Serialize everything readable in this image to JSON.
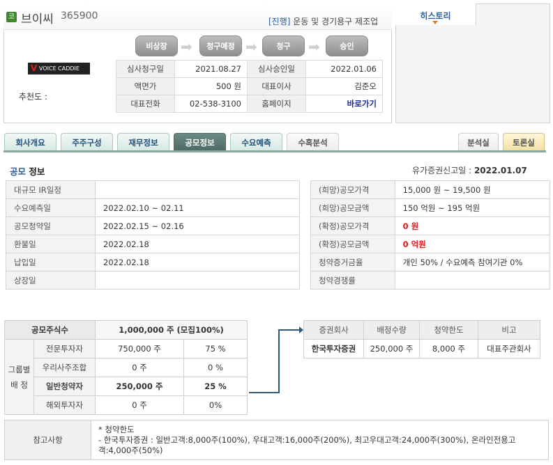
{
  "company": {
    "icon_char": "코",
    "name": "브이씨",
    "code": "365900",
    "status_tag": "[진행]",
    "industry": "운동 및 경기용구 제조업",
    "logo_text": "VOICE CADDIE",
    "recommend_label": "추천도 :"
  },
  "steps": [
    "비상장",
    "청구예정",
    "청구",
    "승인"
  ],
  "info_rows": [
    {
      "l1": "심사청구일",
      "v1": "2021.08.27",
      "l2": "심사승인일",
      "v2": "2022.01.06"
    },
    {
      "l1": "액면가",
      "v1": "500 원",
      "l2": "대표이사",
      "v2": "김준오"
    },
    {
      "l1": "대표전화",
      "v1": "02-538-3100",
      "l2": "홈페이지",
      "v2": "바로가기"
    }
  ],
  "history": {
    "tab_label": "히스토리"
  },
  "tabs": [
    "회사개요",
    "주주구성",
    "재무정보",
    "공모정보",
    "수요예측",
    "수혹분석"
  ],
  "right_tabs": [
    "분석실",
    "토론실"
  ],
  "section": {
    "title_a": "공모",
    "title_b": " 정보",
    "filed_label": "유가증권신고일 : ",
    "filed_date": "2022.01.07"
  },
  "schedule": [
    {
      "label": "대규모 IR일정",
      "value": ""
    },
    {
      "label": "수요예측일",
      "value": "2022.02.10 ~ 02.11"
    },
    {
      "label": "공모청약일",
      "value": "2022.02.15 ~ 02.16"
    },
    {
      "label": "환불일",
      "value": "2022.02.18"
    },
    {
      "label": "납입일",
      "value": "2022.02.18"
    },
    {
      "label": "상장일",
      "value": ""
    }
  ],
  "pricing": [
    {
      "label": "(희망)공모가격",
      "value": "15,000 원 ~ 19,500 원",
      "red": false
    },
    {
      "label": "(희망)공모금액",
      "value": "150 억원  ~ 195 억원",
      "red": false
    },
    {
      "label": "(확정)공모가격",
      "value": "0 원",
      "red": true
    },
    {
      "label": "(확정)공모금액",
      "value": "0 억원",
      "red": true
    },
    {
      "label": "청약증거금율",
      "value": "개인 50% / 수요예측 참여기관 0%",
      "red": false
    },
    {
      "label": "청약경쟁률",
      "value": "",
      "red": false
    }
  ],
  "shares": {
    "head_label": "공모주식수",
    "head_value": "1,000,000  주 (모집100%)",
    "group_label_1": "그룹별",
    "group_label_2": "배 정",
    "rows": [
      {
        "label": "전문투자자",
        "shares": "750,000 주",
        "pct": "75 %",
        "bold": false
      },
      {
        "label": "우리사주조합",
        "shares": "0 주",
        "pct": "0 %",
        "bold": false
      },
      {
        "label": "일반청약자",
        "shares": "250,000  주",
        "pct": "25 %",
        "bold": true
      },
      {
        "label": "해외투자자",
        "shares": "0 주",
        "pct": "0%",
        "bold": false
      }
    ]
  },
  "underwriters": {
    "headers": [
      "증권회사",
      "배정수량",
      "청약한도",
      "비고"
    ],
    "rows": [
      {
        "firm": "한국투자증권",
        "qty": "250,000 주",
        "limit": "8,000 주",
        "note": "대표주관회사"
      }
    ]
  },
  "notes": {
    "label": "참고사항",
    "line1": "* 청약한도",
    "line2": "- 한국투자증권 : 일반고객:8,000주(100%), 우대고객:16,000주(200%), 최고우대고객:24,000주(300%), 온라인전용고객:4,000주(50%)"
  }
}
